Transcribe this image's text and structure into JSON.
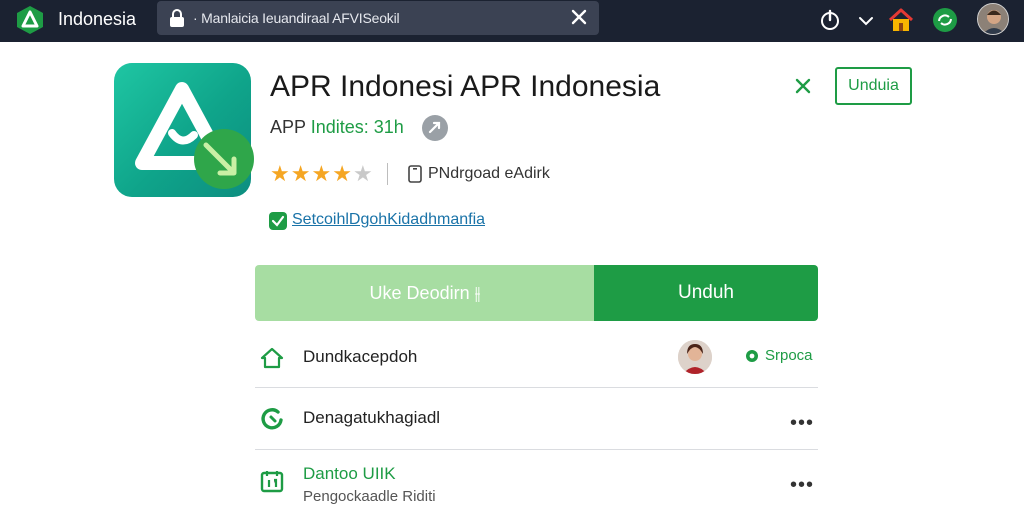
{
  "topbar": {
    "app_name": "Indonesia",
    "url": "· Manlaicia Ieuandiraal AFVISeokil",
    "icons": [
      "logo-icon",
      "lock-icon",
      "close-icon",
      "power-icon",
      "chevron-down-icon",
      "home-icon",
      "sync-icon",
      "avatar"
    ]
  },
  "app": {
    "title": "APR Indonesi APR Indonesia",
    "subtitle_prefix": "APP",
    "subtitle_highlight": "Indites: 31h",
    "rating": 4,
    "rating_max": 5,
    "device_text": "PNdrgoad eAdirk",
    "verified_link": "SetcoihlDgohKidadhmanfia",
    "top_download_label": "Unduia"
  },
  "actions": {
    "secondary_label": "Uke Deodirn ⫲",
    "primary_label": "Unduh"
  },
  "list": {
    "row1": {
      "label": "Dundkacepdoh",
      "badge_label": "Srpoca"
    },
    "row2": {
      "label": "Denagatukhagiadl",
      "more": "•••"
    },
    "row3": {
      "label": "Dantoo UIIK",
      "sublabel": "Pengockaadle Riditi",
      "more": "•••"
    }
  },
  "colors": {
    "topbar_bg": "#1b2231",
    "accent_green": "#1e9c45",
    "light_green": "#a7dda2",
    "app_icon_teal": "#10a98c",
    "star": "#f5a623"
  }
}
